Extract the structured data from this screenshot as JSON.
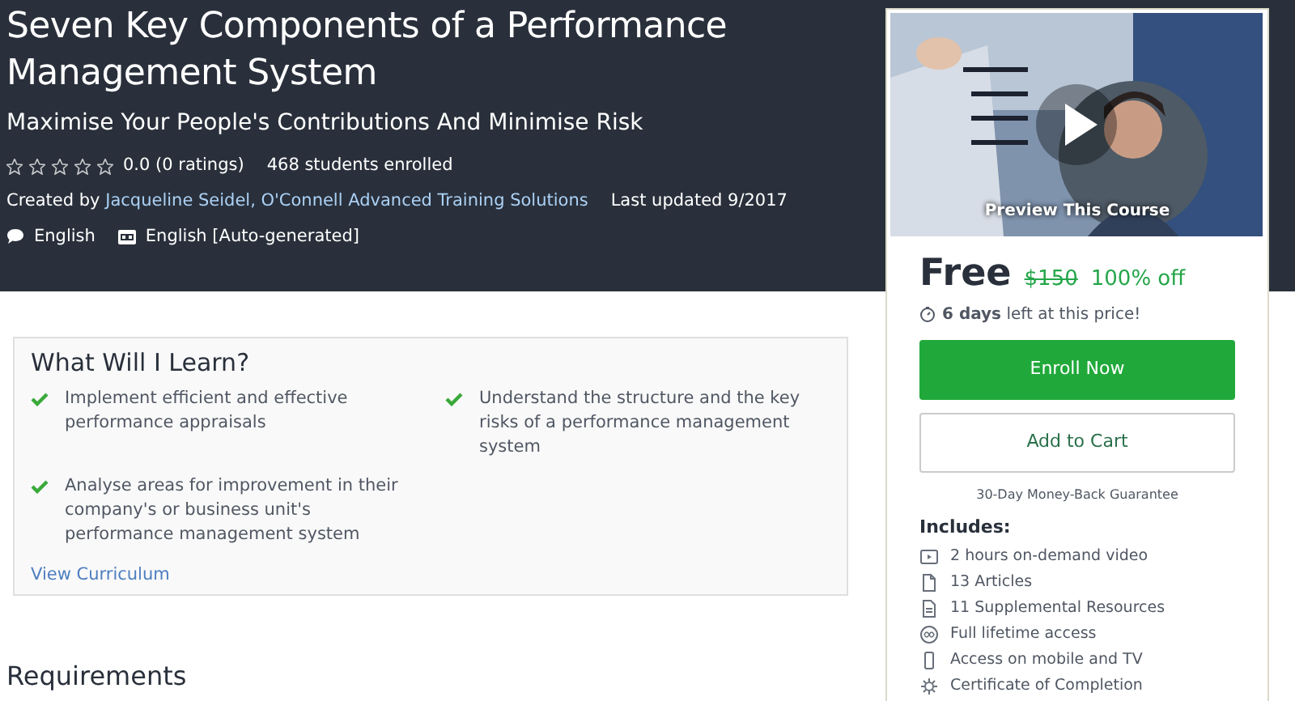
{
  "course": {
    "title": "Seven Key Components of a Performance Management System",
    "subtitle": "Maximise Your People's Contributions And Minimise Risk",
    "stars": 0,
    "rating": "0.0 (0 ratings)",
    "enrolled": "468 students enrolled",
    "created_by_label": "Created by",
    "authors": "Jacqueline Seidel, O'Connell Advanced Training Solutions",
    "updated": "Last updated 9/2017",
    "language": "English",
    "captions": "English [Auto-generated]"
  },
  "learn": {
    "title": "What Will I Learn?",
    "items": [
      {
        "text": "Implement efficient and effective performance appraisals"
      },
      {
        "text": "Understand the structure and the key risks of a performance management system"
      },
      {
        "text": "Analyse areas for improvement in their company's or business unit's performance management system"
      }
    ],
    "link": "View Curriculum"
  },
  "requirements": {
    "title": "Requirements"
  },
  "sidebar": {
    "preview": "Preview This Course",
    "price": "Free",
    "old_price": "$150",
    "discount": "100% off",
    "countdown_bold": "6 days",
    "countdown_rest": "left at this price!",
    "enroll": "Enroll Now",
    "cart": "Add to Cart",
    "guarantee": "30-Day Money-Back Guarantee",
    "includes_title": "Includes:",
    "includes": [
      {
        "kind": "video",
        "text": "2 hours on-demand video"
      },
      {
        "kind": "article",
        "text": "13 Articles"
      },
      {
        "kind": "resource",
        "text": "11 Supplemental Resources"
      },
      {
        "kind": "lifetime",
        "text": "Full lifetime access"
      },
      {
        "kind": "mobile",
        "text": "Access on mobile and TV"
      },
      {
        "kind": "certificate",
        "text": "Certificate of Completion"
      }
    ]
  }
}
